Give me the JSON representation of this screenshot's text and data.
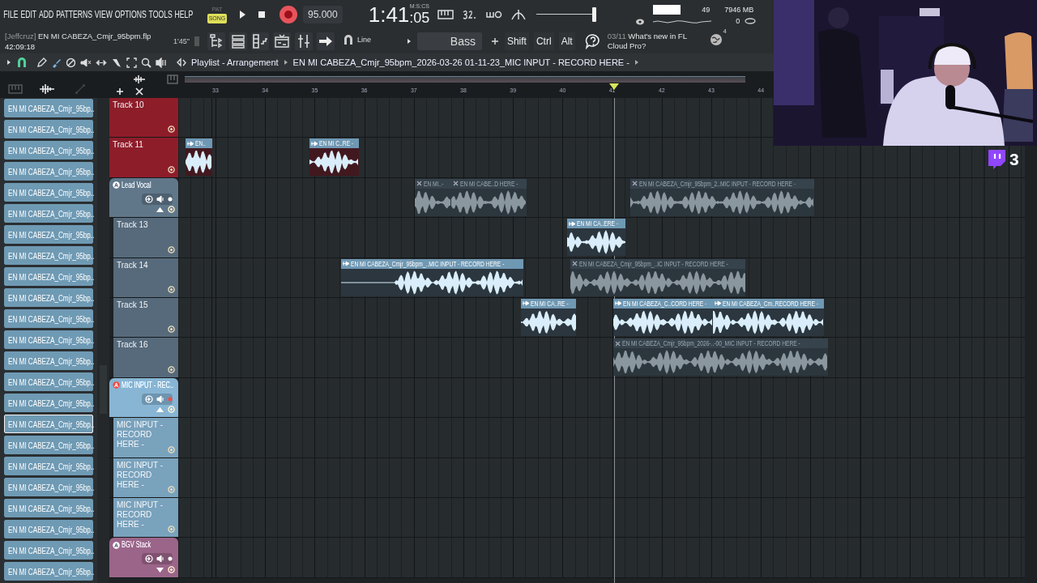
{
  "menu": [
    "FILE",
    "EDIT",
    "ADD",
    "PATTERNS",
    "VIEW",
    "OPTIONS",
    "TOOLS",
    "HELP"
  ],
  "transport": {
    "modes": [
      {
        "label": "PAT",
        "selected": false
      },
      {
        "label": "SONG",
        "selected": true
      }
    ],
    "tempo": "95.000",
    "time": "1:41",
    "time_fraction": ":05",
    "time_unit": "M:S:CS"
  },
  "master_volume": {
    "level": 0.96
  },
  "monitor": {
    "cpu": "49",
    "memory": "7946 MB",
    "polyphony": "0"
  },
  "project": {
    "user": "[Jeffcruz]",
    "file": "EN MI CABEZA_Cmjr_95bpm.flp",
    "elapsed": "42:09:18",
    "length": "1'45\""
  },
  "snap": "Line",
  "preset": "Bass",
  "modifiers": [
    "Shift",
    "Ctrl",
    "Alt"
  ],
  "news": {
    "date": "03/11",
    "text": "What's new in FL Cloud Pro?"
  },
  "globe_badge": "4",
  "playlist": {
    "title": "Playlist - Arrangement",
    "arrangement": "EN MI CABEZA_Cmjr_95bpm_2026-03-26 01-11-23_MIC INPUT - RECORD HERE -",
    "ruler": [
      "33",
      "34",
      "35",
      "36",
      "37",
      "38",
      "39",
      "40",
      "41",
      "42",
      "43",
      "44"
    ],
    "tracks": [
      {
        "name": "Track 10",
        "kind": "track",
        "color": "#8e1d2a"
      },
      {
        "name": "Track 11",
        "kind": "track",
        "color": "#8e1d2a",
        "clips": [
          {
            "label": "EN..",
            "muted": false
          },
          {
            "label": "EN MI C..RE -",
            "muted": false
          }
        ]
      },
      {
        "name": "Lead Vocal",
        "kind": "group",
        "color": "#566a7b",
        "armed": false,
        "expanded": true,
        "clips": [
          {
            "label": "EN MI..-",
            "muted": true
          },
          {
            "label": "EN MI CABE..D HERE -",
            "muted": true
          },
          {
            "label": "EN MI CABEZA_Cmjr_95bpm_2..MIC INPUT - RECORD HERE -",
            "muted": true
          }
        ],
        "children": [
          {
            "name": "Track 13",
            "kind": "track",
            "color": "#566a7b",
            "clips": [
              {
                "label": "EN MI CA..ERE -",
                "muted": false
              }
            ]
          },
          {
            "name": "Track 14",
            "kind": "track",
            "color": "#566a7b",
            "clips": [
              {
                "label": "EN MI CABEZA_Cmjr_95bpm_..MIC INPUT - RECORD HERE -",
                "muted": false
              },
              {
                "label": "EN MI CABEZA_Cmjr_95bpm_..IC INPUT - RECORD HERE -",
                "muted": true
              }
            ]
          },
          {
            "name": "Track 15",
            "kind": "track",
            "color": "#566a7b",
            "clips": [
              {
                "label": "EN MI CA..RE -",
                "muted": false
              },
              {
                "label": "EN MI CABEZA_C..CORD HERE -",
                "muted": false
              },
              {
                "label": "EN MI CABEZA_Cm..RECORD HERE -",
                "muted": false
              }
            ]
          },
          {
            "name": "Track 16",
            "kind": "track",
            "color": "#566a7b",
            "clips": [
              {
                "label": "EN MI CABEZA_Cmjr_95bpm_2026-..-00_MIC INPUT - RECORD HERE -",
                "muted": true
              }
            ]
          }
        ]
      },
      {
        "name": "MIC INPUT - REC..",
        "kind": "group",
        "color": "#79a2bd",
        "armed": true,
        "expanded": true,
        "children": [
          {
            "name": "MIC INPUT - RECORD HERE -",
            "kind": "track",
            "color": "#79a2bd"
          },
          {
            "name": "MIC INPUT - RECORD HERE -",
            "kind": "track",
            "color": "#79a2bd"
          },
          {
            "name": "MIC INPUT - RECORD HERE -",
            "kind": "track",
            "color": "#79a2bd"
          }
        ]
      },
      {
        "name": "BGV Stack",
        "kind": "group",
        "color": "#8a5a7b",
        "armed": false,
        "expanded": false
      }
    ]
  },
  "browser": {
    "items": [
      {
        "label": "EN MI CABEZA_Cmjr_95bp..",
        "selected": false
      },
      {
        "label": "EN MI CABEZA_Cmjr_95bp..",
        "selected": false
      },
      {
        "label": "EN MI CABEZA_Cmjr_95bp..",
        "selected": false
      },
      {
        "label": "EN MI CABEZA_Cmjr_95bp..",
        "selected": false
      },
      {
        "label": "EN MI CABEZA_Cmjr_95bp..",
        "selected": false
      },
      {
        "label": "EN MI CABEZA_Cmjr_95bp..",
        "selected": false
      },
      {
        "label": "EN MI CABEZA_Cmjr_95bp..",
        "selected": false
      },
      {
        "label": "EN MI CABEZA_Cmjr_95bp..",
        "selected": false
      },
      {
        "label": "EN MI CABEZA_Cmjr_95bp..",
        "selected": false
      },
      {
        "label": "EN MI CABEZA_Cmjr_95bp..",
        "selected": false
      },
      {
        "label": "EN MI CABEZA_Cmjr_95bp..",
        "selected": false
      },
      {
        "label": "EN MI CABEZA_Cmjr_95bp..",
        "selected": false
      },
      {
        "label": "EN MI CABEZA_Cmjr_95bp..",
        "selected": false
      },
      {
        "label": "EN MI CABEZA_Cmjr_95bp..",
        "selected": false
      },
      {
        "label": "EN MI CABEZA_Cmjr_95bp..",
        "selected": false
      },
      {
        "label": "EN MI CABEZA_Cmjr_95bp..",
        "selected": true
      },
      {
        "label": "EN MI CABEZA_Cmjr_95bp..",
        "selected": false
      },
      {
        "label": "EN MI CABEZA_Cmjr_95bp..",
        "selected": false
      },
      {
        "label": "EN MI CABEZA_Cmjr_95bp..",
        "selected": false
      },
      {
        "label": "EN MI CABEZA_Cmjr_95bp..",
        "selected": false
      },
      {
        "label": "EN MI CABEZA_Cmjr_95bp..",
        "selected": false
      },
      {
        "label": "EN MI CABEZA_Cmjr_95bp..",
        "selected": false
      },
      {
        "label": "EN MI CABEZA_Cmjr_95bp..",
        "selected": false
      }
    ]
  },
  "stream": {
    "viewers": "3"
  }
}
